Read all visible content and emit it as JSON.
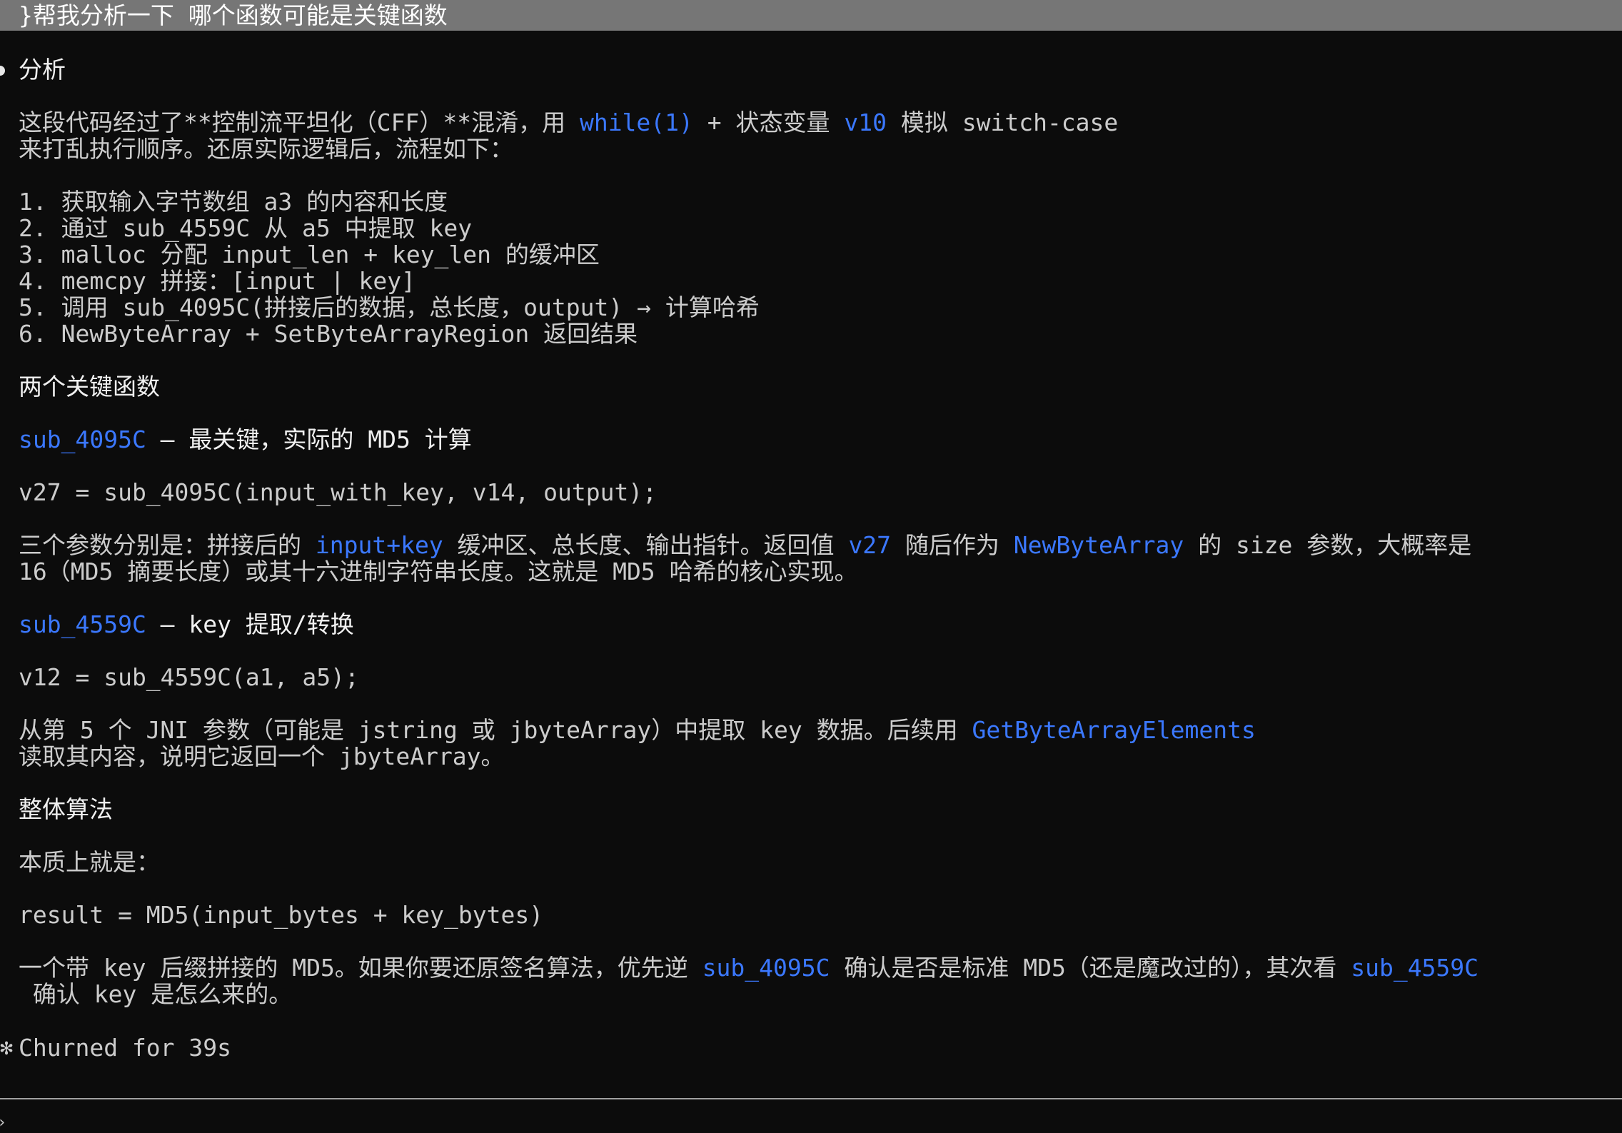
{
  "prompt": {
    "text": "}帮我分析一下 哪个函数可能是关键函数"
  },
  "response": {
    "heading": "分析",
    "intro_line1_pre": "这段代码经过了**控制流平坦化（CFF）**混淆，用 ",
    "intro_line1_code1": "while(1)",
    "intro_line1_mid": " + 状态变量 ",
    "intro_line1_code2": "v10",
    "intro_line1_post": " 模拟 switch-case",
    "intro_line2": "来打乱执行顺序。还原实际逻辑后，流程如下：",
    "steps": [
      "1. 获取输入字节数组 a3 的内容和长度",
      "2. 通过 sub_4559C 从 a5 中提取 key",
      "3. malloc 分配 input_len + key_len 的缓冲区",
      "4. memcpy 拼接：[input | key]",
      "5. 调用 sub_4095C(拼接后的数据，总长度，output) → 计算哈希",
      "6. NewByteArray + SetByteArrayRegion 返回结果"
    ],
    "key_funcs_heading": "两个关键函数",
    "f1_name": "sub_4095C",
    "f1_desc": " — 最关键，实际的 MD5 计算",
    "f1_code": "v27 = sub_4095C(input_with_key, v14, output);",
    "f1_p1_pre": "三个参数分别是：拼接后的 ",
    "f1_p1_code1": "input+key",
    "f1_p1_mid": " 缓冲区、总长度、输出指针。返回值 ",
    "f1_p1_code2": "v27",
    "f1_p1_mid2": " 随后作为 ",
    "f1_p1_code3": "NewByteArray",
    "f1_p1_post": " 的 size 参数，大概率是",
    "f1_p2": "16（MD5 摘要长度）或其十六进制字符串长度。这就是 MD5 哈希的核心实现。",
    "f2_name": "sub_4559C",
    "f2_desc": " — key 提取/转换",
    "f2_code": "v12 = sub_4559C(a1, a5);",
    "f2_p1_pre": "从第 5 个 JNI 参数（可能是 jstring 或 jbyteArray）中提取 key 数据。后续用 ",
    "f2_p1_code": "GetByteArrayElements",
    "f2_p2": "读取其内容，说明它返回一个 jbyteArray。",
    "algo_heading": "整体算法",
    "algo_intro": "本质上就是：",
    "algo_code": "result = MD5(input_bytes + key_bytes)",
    "concl_pre": "一个带 key 后缀拼接的 MD5。如果你要还原签名算法，优先逆 ",
    "concl_code1": "sub_4095C",
    "concl_mid": " 确认是否是标准 MD5（还是魔改过的），其次看 ",
    "concl_code2": "sub_4559C",
    "concl_line2": " 确认 key 是怎么来的。"
  },
  "status": {
    "spinner_glyph": "✻",
    "text": "Churned for 39s"
  },
  "input": {
    "caret": "›"
  },
  "colors": {
    "background": "#0c0c0c",
    "text": "#cccccc",
    "code_highlight": "#3b78ff",
    "prompt_bar": "#767676"
  }
}
